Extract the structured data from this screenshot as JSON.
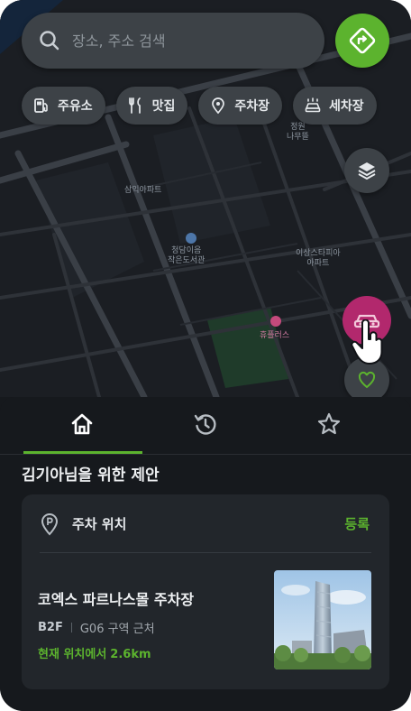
{
  "search": {
    "placeholder": "장소, 주소 검색"
  },
  "chips": [
    {
      "label": "주유소",
      "icon": "gas-station-icon"
    },
    {
      "label": "맛집",
      "icon": "fork-knife-icon"
    },
    {
      "label": "주차장",
      "icon": "location-pin-icon"
    },
    {
      "label": "세차장",
      "icon": "car-wash-icon"
    }
  ],
  "map": {
    "pois": [
      {
        "label": "정원\n나무뜰"
      },
      {
        "label": "삼익아파트"
      },
      {
        "label": "청담이음\n작은도서관"
      },
      {
        "label": "이상스타피아\n아파트"
      },
      {
        "label": "휴플러스"
      }
    ]
  },
  "tabs": [
    {
      "name": "home",
      "icon": "home-icon"
    },
    {
      "name": "recent",
      "icon": "history-icon"
    },
    {
      "name": "favorites",
      "icon": "star-icon"
    }
  ],
  "suggestion": {
    "title": "김기아님을 위한 제안",
    "card": {
      "header_label": "주차 위치",
      "action_label": "등록",
      "place_name": "코엑스 파르나스몰 주차장",
      "floor": "B2F",
      "zone": "G06 구역 근처",
      "distance_prefix": "현재 위치에서",
      "distance_value": "2.6km"
    }
  },
  "colors": {
    "accent": "#5cb32e",
    "parking_fab": "#b2286d",
    "surface": "#22262b"
  }
}
